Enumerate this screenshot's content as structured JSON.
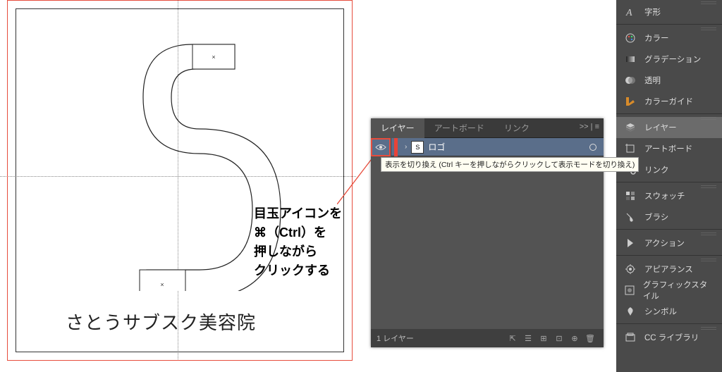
{
  "canvas": {
    "logo_text": "さとうサブスク美容院",
    "annotation": "目玉アイコンを\n⌘（Ctrl）を\n押しながら\nクリックする"
  },
  "layers_panel": {
    "tabs": [
      "レイヤー",
      "アートボード",
      "リンク"
    ],
    "active_tab": 0,
    "menu_symbol": ">> | ≡",
    "layer": {
      "name": "ロゴ",
      "thumb_text": "S",
      "expand_glyph": "›"
    },
    "tooltip": "表示を切り換え (Ctrl キーを押しながらクリックして表示モードを切り換え)",
    "footer": {
      "count": "1 レイヤー",
      "icons": [
        "⇱",
        "☰",
        "⊞",
        "⊡",
        "⊕",
        "🗑"
      ]
    }
  },
  "sidebar": {
    "groups": [
      {
        "items": [
          {
            "label": "字形",
            "icon": "font"
          }
        ]
      },
      {
        "items": [
          {
            "label": "カラー",
            "icon": "palette"
          },
          {
            "label": "グラデーション",
            "icon": "gradient"
          },
          {
            "label": "透明",
            "icon": "transparency"
          },
          {
            "label": "カラーガイド",
            "icon": "colorguide"
          }
        ]
      },
      {
        "items": [
          {
            "label": "レイヤー",
            "icon": "layers",
            "active": true
          },
          {
            "label": "アートボード",
            "icon": "artboard"
          },
          {
            "label": "リンク",
            "icon": "link"
          }
        ]
      },
      {
        "items": [
          {
            "label": "スウォッチ",
            "icon": "swatches"
          },
          {
            "label": "ブラシ",
            "icon": "brush"
          }
        ]
      },
      {
        "items": [
          {
            "label": "アクション",
            "icon": "action"
          }
        ]
      },
      {
        "items": [
          {
            "label": "アピアランス",
            "icon": "appearance"
          },
          {
            "label": "グラフィックスタイル",
            "icon": "graphicstyle"
          },
          {
            "label": "シンボル",
            "icon": "symbol"
          }
        ]
      },
      {
        "items": [
          {
            "label": "CC ライブラリ",
            "icon": "cclib"
          }
        ]
      }
    ]
  }
}
